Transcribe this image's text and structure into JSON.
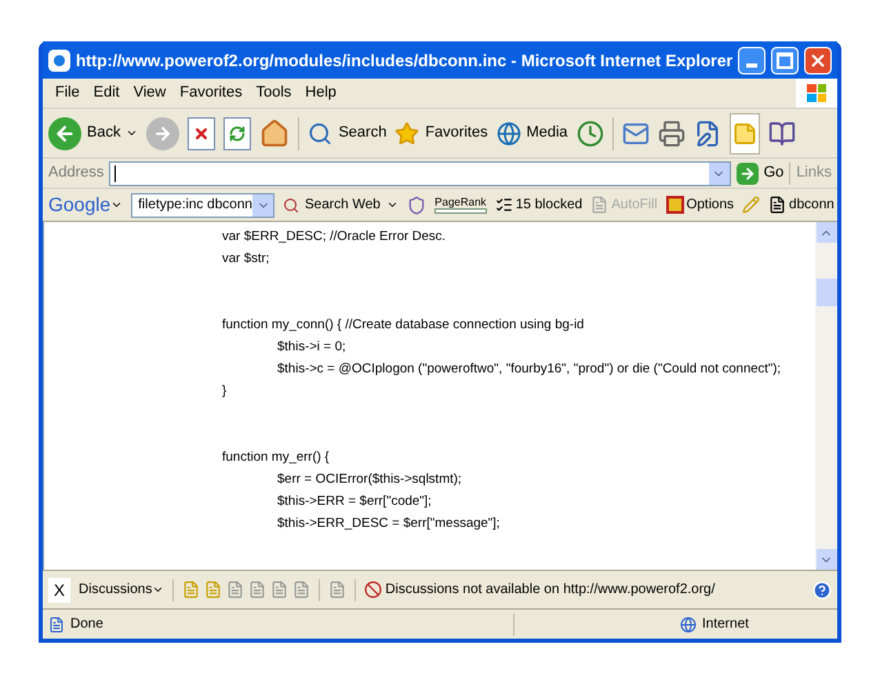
{
  "window": {
    "title": "http://www.powerof2.org/modules/includes/dbconn.inc - Microsoft Internet Explorer"
  },
  "menu": [
    "File",
    "Edit",
    "View",
    "Favorites",
    "Tools",
    "Help"
  ],
  "toolbar": [
    {
      "kind": "back",
      "label": "Back"
    },
    {
      "kind": "search",
      "label": "Search"
    },
    {
      "kind": "favorites",
      "label": "Favorites"
    },
    {
      "kind": "media",
      "label": "Media"
    }
  ],
  "address": {
    "label": "Address",
    "go": "Go",
    "links": "Links"
  },
  "google": {
    "label": "Google",
    "query": "filetype:inc dbconn",
    "search_button": "Search Web",
    "pagerank": "PageRank",
    "blocked": "15 blocked",
    "autofill": {
      "label": "AutoFill",
      "disabled": true
    },
    "options": "Options",
    "highlight": "dbconn"
  },
  "code": [
    [
      {
        "text": "var $ERR_DESC; //Oracle Error Desc."
      },
      {
        "text": "var $str;"
      }
    ],
    [
      {
        "text": "function my_conn() { //Create database connection using bg-id",
        "children": [
          {
            "text": "$this->i = 0;"
          },
          {
            "text": "$this->c = @OCIplogon (\"poweroftwo\", \"fourby16\", \"prod\") or die (\"Could not connect\");"
          }
        ]
      },
      {
        "text": "}"
      }
    ],
    [
      {
        "text": "function my_err() {",
        "children": [
          {
            "text": "$err = OCIError($this->sqlstmt);"
          },
          {
            "text": "$this->ERR = $err[\"code\"];"
          },
          {
            "text": "$this->ERR_DESC = $err[\"message\"];"
          }
        ]
      }
    ]
  ],
  "discussions": {
    "close": "X",
    "label": "Discussions",
    "message": "Discussions not available on http://www.powerof2.org/"
  },
  "status": {
    "text": "Done",
    "zone": "Internet"
  }
}
